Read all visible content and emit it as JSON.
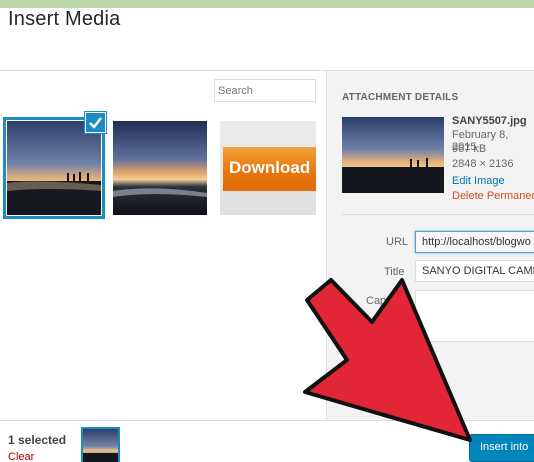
{
  "header": {
    "title": "Insert Media"
  },
  "library": {
    "search_placeholder": "Search",
    "items": [
      {
        "kind": "photo",
        "selected": true
      },
      {
        "kind": "photo",
        "selected": false
      },
      {
        "kind": "banner",
        "label": "Download I",
        "selected": false
      }
    ]
  },
  "details": {
    "heading": "ATTACHMENT DETAILS",
    "filename": "SANY5507.jpg",
    "date": "February 8, 2015",
    "filesize": "967 kB",
    "dimensions": "2848 × 2136",
    "edit_link": "Edit Image",
    "delete_link": "Delete Permanen",
    "fields": {
      "url_label": "URL",
      "url_value": "http://localhost/blogwo",
      "title_label": "Title",
      "title_value": "SANYO DIGITAL CAMER",
      "caption_label": "Caption"
    }
  },
  "footer": {
    "selected_count": "1 selected",
    "clear_link": "Clear",
    "insert_button": "Insert into"
  },
  "icons": {
    "selected_check": "check-icon",
    "annotation": "red-arrow"
  },
  "colors": {
    "accent": "#1e8cbe",
    "primary_button": "#0085ba",
    "banner_orange": "#e8770c",
    "annotation_red": "#e32636",
    "delete_red": "#d54e21",
    "top_bar": "#bcd7a7"
  }
}
